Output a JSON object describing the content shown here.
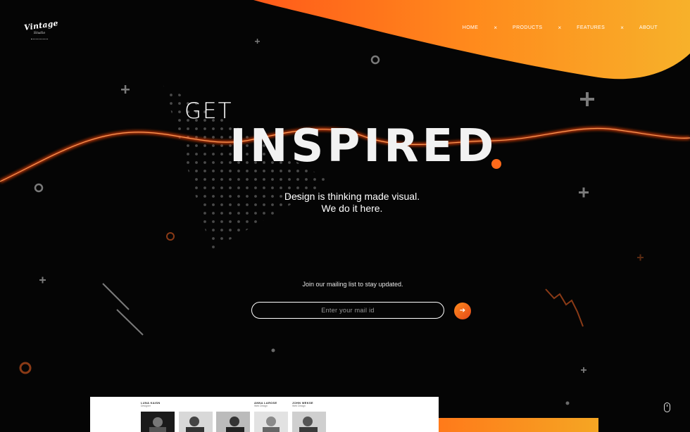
{
  "brand": {
    "logo_text": "Vintage",
    "logo_sub": "Studio"
  },
  "nav": {
    "items": [
      {
        "label": "HOME"
      },
      {
        "label": "PRODUCTS"
      },
      {
        "label": "FEATURES"
      },
      {
        "label": "ABOUT"
      }
    ],
    "separator": "×"
  },
  "hero": {
    "line1": "GET",
    "line2": "INSPIRED",
    "tagline_line1": "Design is thinking made visual.",
    "tagline_line2": "We do it here."
  },
  "newsletter": {
    "label": "Join our mailing list to stay updated.",
    "email_placeholder": "Enter your mail id",
    "email_value": "",
    "submit_icon": "arrow-right-icon",
    "submit_glyph": "➔"
  },
  "preview": {
    "team": [
      {
        "name": "LUNA KAISN",
        "role": "Designer"
      },
      {
        "name": "ANNA LAROSE",
        "role": "Web Design"
      },
      {
        "name": "JOHN WEKSE",
        "role": "Web Design"
      }
    ]
  },
  "colors": {
    "background": "#050505",
    "accent_orange": "#ff6a1a",
    "accent_gold": "#f7b12a",
    "text": "#ffffff"
  }
}
